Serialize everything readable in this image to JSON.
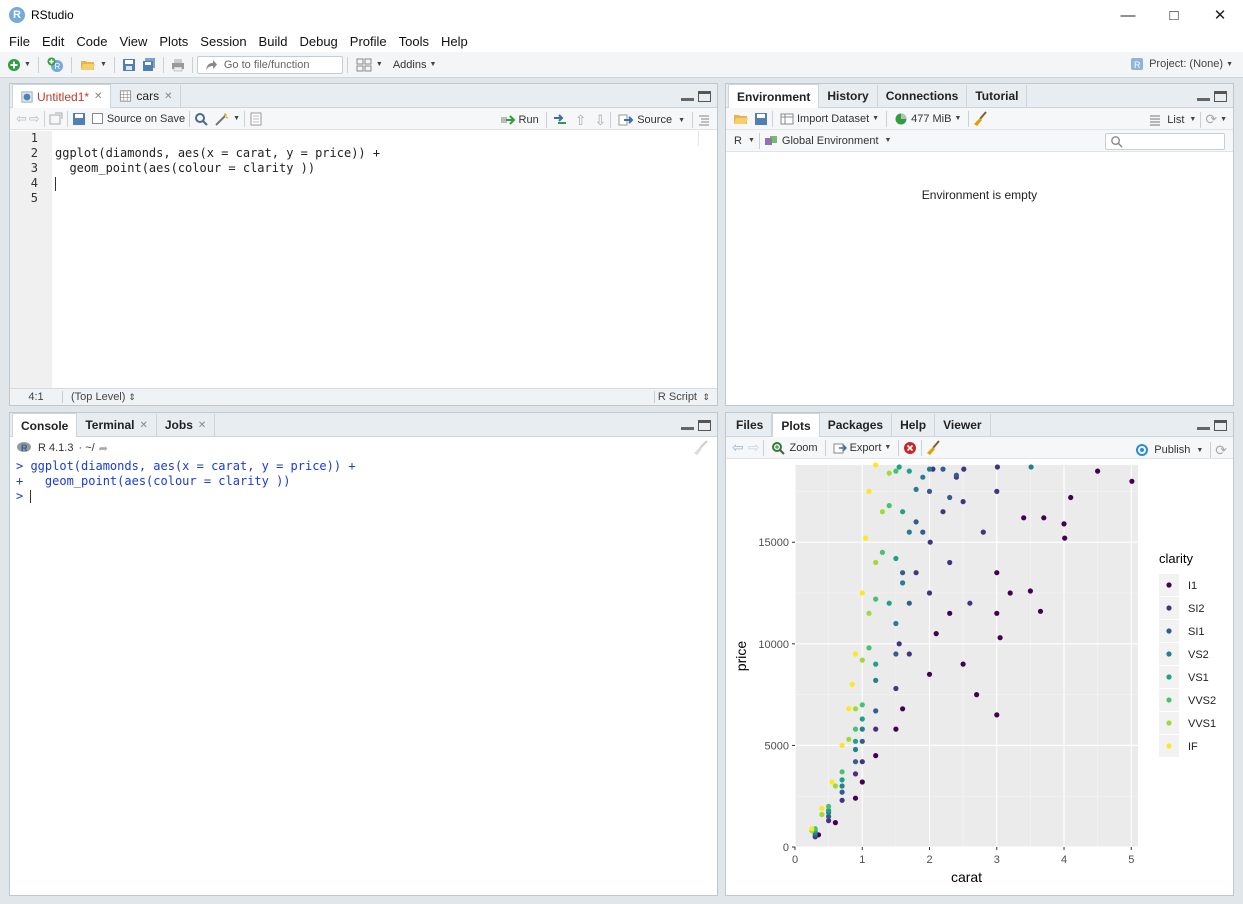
{
  "window": {
    "title": "RStudio",
    "app_icon_letter": "R"
  },
  "menu": [
    "File",
    "Edit",
    "Code",
    "View",
    "Plots",
    "Session",
    "Build",
    "Debug",
    "Profile",
    "Tools",
    "Help"
  ],
  "main_toolbar": {
    "goto_placeholder": "Go to file/function",
    "addins_label": "Addins",
    "project_label": "Project: (None)"
  },
  "source_pane": {
    "tabs": [
      {
        "label": "Untitled1*"
      },
      {
        "label": "cars"
      }
    ],
    "source_on_save_label": "Source on Save",
    "run_label": "Run",
    "source_label": "Source",
    "line_numbers": [
      "1",
      "2",
      "3",
      "4",
      "5"
    ],
    "code_lines": [
      "",
      "ggplot(diamonds, aes(x = carat, y = price)) +",
      "  geom_point(aes(colour = clarity ))",
      "",
      ""
    ],
    "status": {
      "position": "4:1",
      "scope": "(Top Level)",
      "filetype": "R Script"
    }
  },
  "env_pane": {
    "tabs": [
      "Environment",
      "History",
      "Connections",
      "Tutorial"
    ],
    "import_label": "Import Dataset",
    "memory_label": "477 MiB",
    "list_label": "List",
    "language_label": "R",
    "scope_label": "Global Environment",
    "empty_message": "Environment is empty"
  },
  "console_pane": {
    "tabs": [
      "Console",
      "Terminal",
      "Jobs"
    ],
    "version_label": "R 4.1.3",
    "path_label": "· ~/",
    "lines": [
      "> ggplot(diamonds, aes(x = carat, y = price)) +",
      "+   geom_point(aes(colour = clarity ))",
      "> "
    ]
  },
  "files_pane": {
    "tabs": [
      "Files",
      "Plots",
      "Packages",
      "Help",
      "Viewer"
    ],
    "zoom_label": "Zoom",
    "export_label": "Export",
    "publish_label": "Publish"
  },
  "chart_data": {
    "type": "scatter",
    "title": "",
    "xlabel": "carat",
    "ylabel": "price",
    "xlim": [
      0,
      5.1
    ],
    "ylim": [
      0,
      18800
    ],
    "x_ticks": [
      "0",
      "1",
      "2",
      "3",
      "4",
      "5"
    ],
    "y_ticks": [
      "0",
      "5000",
      "10000",
      "15000"
    ],
    "legend_title": "clarity",
    "legend_position": "right",
    "grid": true,
    "series": [
      {
        "name": "I1",
        "color": "#440154",
        "points": [
          [
            0.35,
            600
          ],
          [
            0.6,
            1200
          ],
          [
            0.9,
            2400
          ],
          [
            1.0,
            3200
          ],
          [
            1.2,
            4500
          ],
          [
            1.5,
            5800
          ],
          [
            1.6,
            6800
          ],
          [
            2.0,
            8500
          ],
          [
            2.1,
            10500
          ],
          [
            2.3,
            11500
          ],
          [
            2.5,
            9000
          ],
          [
            3.0,
            6500
          ],
          [
            3.0,
            11500
          ],
          [
            3.2,
            12500
          ],
          [
            3.5,
            12600
          ],
          [
            3.65,
            11600
          ],
          [
            3.7,
            16200
          ],
          [
            4.0,
            15900
          ],
          [
            4.1,
            17200
          ],
          [
            4.5,
            18500
          ],
          [
            5.01,
            18000
          ],
          [
            2.7,
            7500
          ],
          [
            3.0,
            13500
          ],
          [
            3.4,
            16200
          ],
          [
            4.01,
            15200
          ],
          [
            3.05,
            10300
          ]
        ]
      },
      {
        "name": "SI2",
        "color": "#46327e",
        "points": [
          [
            0.3,
            500
          ],
          [
            0.5,
            1300
          ],
          [
            0.7,
            2300
          ],
          [
            0.9,
            3600
          ],
          [
            1.0,
            4200
          ],
          [
            1.2,
            5800
          ],
          [
            1.5,
            7800
          ],
          [
            1.7,
            9500
          ],
          [
            2.0,
            12500
          ],
          [
            2.01,
            15000
          ],
          [
            2.05,
            18600
          ],
          [
            2.2,
            16500
          ],
          [
            2.3,
            14000
          ],
          [
            2.5,
            17000
          ],
          [
            2.6,
            12000
          ],
          [
            2.8,
            15500
          ],
          [
            3.0,
            17500
          ],
          [
            3.01,
            18700
          ],
          [
            2.51,
            18600
          ],
          [
            1.55,
            10000
          ],
          [
            1.8,
            13500
          ],
          [
            2.4,
            18200
          ]
        ]
      },
      {
        "name": "SI1",
        "color": "#365c8d",
        "points": [
          [
            0.3,
            600
          ],
          [
            0.5,
            1500
          ],
          [
            0.7,
            2700
          ],
          [
            0.9,
            4200
          ],
          [
            1.0,
            5200
          ],
          [
            1.2,
            6700
          ],
          [
            1.5,
            9500
          ],
          [
            1.7,
            12000
          ],
          [
            1.9,
            15500
          ],
          [
            2.0,
            17500
          ],
          [
            2.2,
            18600
          ],
          [
            2.4,
            18300
          ],
          [
            1.8,
            16000
          ],
          [
            1.6,
            13500
          ],
          [
            2.3,
            17200
          ]
        ]
      },
      {
        "name": "VS2",
        "color": "#277f8e",
        "points": [
          [
            0.3,
            700
          ],
          [
            0.5,
            1700
          ],
          [
            0.7,
            3000
          ],
          [
            0.9,
            4800
          ],
          [
            1.0,
            5800
          ],
          [
            1.2,
            8200
          ],
          [
            1.5,
            11000
          ],
          [
            1.6,
            13000
          ],
          [
            1.7,
            15500
          ],
          [
            1.8,
            17600
          ],
          [
            2.0,
            18600
          ],
          [
            3.51,
            18700
          ],
          [
            1.9,
            18200
          ]
        ]
      },
      {
        "name": "VS1",
        "color": "#1fa187",
        "points": [
          [
            0.3,
            800
          ],
          [
            0.5,
            1800
          ],
          [
            0.7,
            3300
          ],
          [
            0.9,
            5200
          ],
          [
            1.0,
            6300
          ],
          [
            1.2,
            9000
          ],
          [
            1.4,
            12000
          ],
          [
            1.5,
            14200
          ],
          [
            1.6,
            16500
          ],
          [
            1.7,
            18500
          ],
          [
            1.55,
            18700
          ]
        ]
      },
      {
        "name": "VVS2",
        "color": "#4ac16d",
        "points": [
          [
            0.3,
            900
          ],
          [
            0.5,
            2000
          ],
          [
            0.7,
            3700
          ],
          [
            0.9,
            5800
          ],
          [
            1.0,
            7000
          ],
          [
            1.1,
            9800
          ],
          [
            1.2,
            12200
          ],
          [
            1.3,
            14500
          ],
          [
            1.4,
            16800
          ],
          [
            1.5,
            18500
          ]
        ]
      },
      {
        "name": "VVS1",
        "color": "#a0da39",
        "points": [
          [
            0.25,
            800
          ],
          [
            0.4,
            1600
          ],
          [
            0.6,
            3000
          ],
          [
            0.8,
            5300
          ],
          [
            0.9,
            6800
          ],
          [
            1.0,
            9200
          ],
          [
            1.1,
            11500
          ],
          [
            1.2,
            14000
          ],
          [
            1.3,
            16500
          ],
          [
            1.4,
            18400
          ]
        ]
      },
      {
        "name": "IF",
        "color": "#fde725",
        "points": [
          [
            0.25,
            900
          ],
          [
            0.4,
            1900
          ],
          [
            0.55,
            3200
          ],
          [
            0.7,
            5000
          ],
          [
            0.8,
            6800
          ],
          [
            0.9,
            9500
          ],
          [
            1.0,
            12500
          ],
          [
            1.05,
            15200
          ],
          [
            1.1,
            17500
          ],
          [
            1.2,
            18800
          ],
          [
            0.85,
            8000
          ]
        ]
      }
    ]
  }
}
